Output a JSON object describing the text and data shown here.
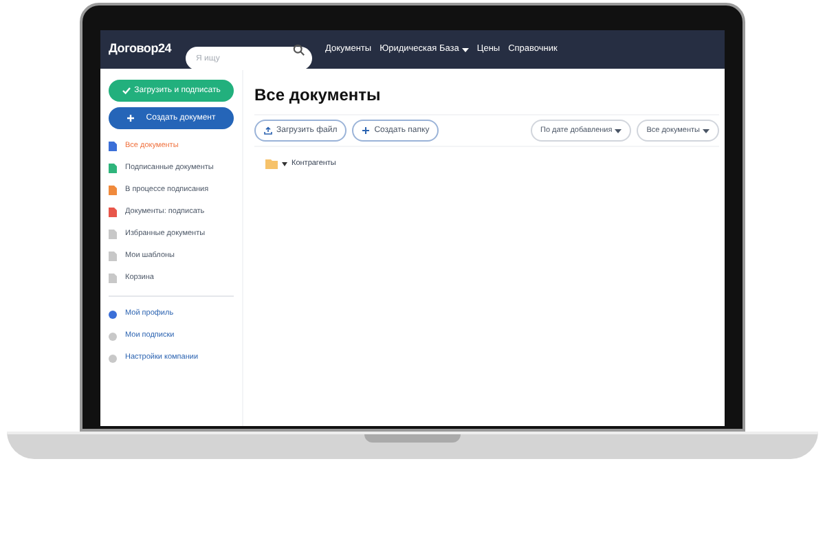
{
  "header": {
    "logo": "Договор24",
    "search": {
      "placeholder": "Я ищу"
    },
    "nav": [
      {
        "label": "Документы",
        "dropdown": false
      },
      {
        "label": "Юридическая База",
        "dropdown": true
      },
      {
        "label": "Цены",
        "dropdown": false
      },
      {
        "label": "Справочник",
        "dropdown": false
      }
    ]
  },
  "sidebar": {
    "primary_button": "Загрузить и подписать",
    "secondary_button": "Создать документ",
    "items": [
      {
        "label": "Все документы",
        "selected": true,
        "color": "#3b6fd8"
      },
      {
        "label": "Подписанные документы",
        "selected": false,
        "color": "#2fb57c"
      },
      {
        "label": "В процессе подписания",
        "selected": false,
        "color": "#f08a3c"
      },
      {
        "label": "Документы: подписать",
        "selected": false,
        "color": "#e8564a"
      },
      {
        "label": "Избранные документы",
        "selected": false,
        "color": "#c8c8c8"
      },
      {
        "label": "Мои шаблоны",
        "selected": false,
        "color": "#c8c8c8"
      },
      {
        "label": "Корзина",
        "selected": false,
        "color": "#c8c8c8"
      }
    ],
    "account_items": [
      {
        "label": "Мой профиль",
        "color": "#3b6fd8"
      },
      {
        "label": "Мои подписки",
        "color": "#c8c8c8"
      },
      {
        "label": "Настройки компании",
        "color": "#c8c8c8"
      }
    ]
  },
  "main": {
    "title": "Все документы",
    "actions": [
      "Загрузить файл",
      "Создать папку"
    ],
    "filters": [
      "По дате добавления",
      "Все документы"
    ],
    "folders": [
      {
        "name": "Контрагенты",
        "expanded": false
      }
    ]
  }
}
